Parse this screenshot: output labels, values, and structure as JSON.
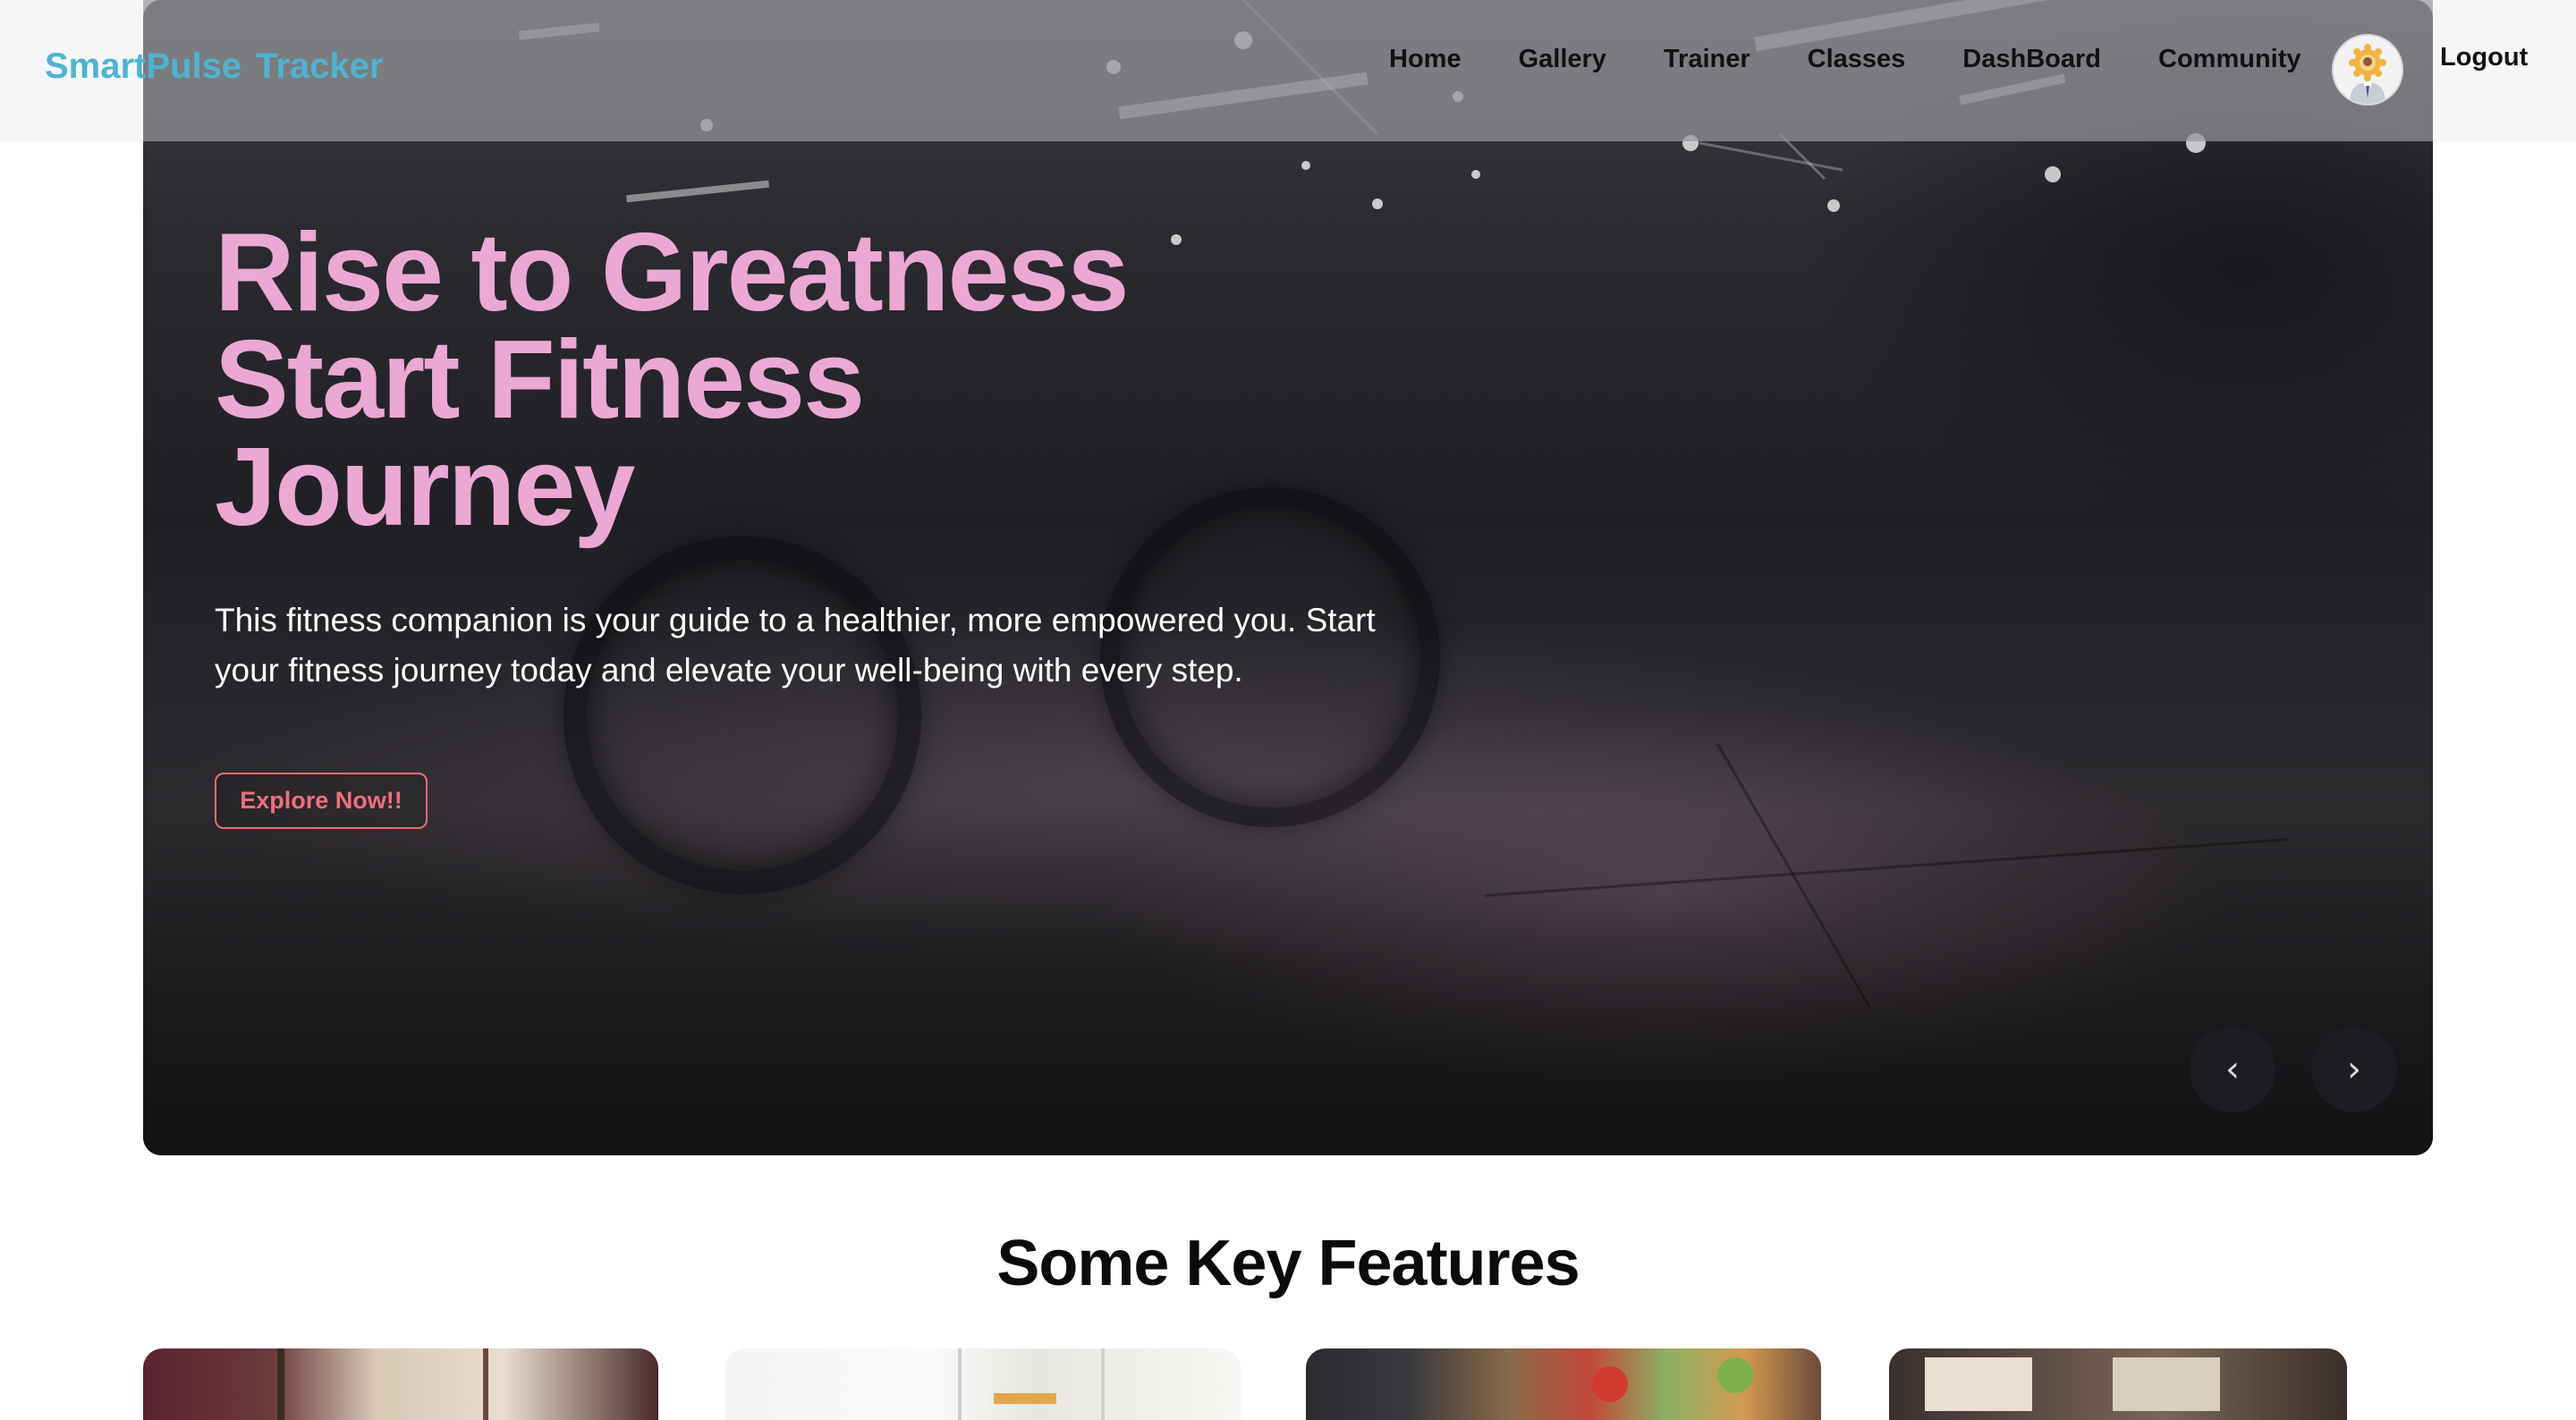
{
  "navbar": {
    "logo_word1": "SmartPulse",
    "logo_word2": "Tracker",
    "links": [
      "Home",
      "Gallery",
      "Trainer",
      "Classes",
      "DashBoard",
      "Community"
    ],
    "logout_label": "Logout",
    "avatar_icon": "user-avatar-icon"
  },
  "hero": {
    "title_lines": [
      "Rise to Greatness",
      "Start Fitness",
      "Journey"
    ],
    "description": "This fitness companion is your guide to a healthier, more empowered you. Start your fitness journey today and elevate your well-being with every step.",
    "cta_label": "Explore Now!!",
    "prev_label": "‹",
    "next_label": "›",
    "title_color": "#eca8d4",
    "cta_color": "#ef6f7c"
  },
  "features": {
    "title": "Some Key Features"
  },
  "colors": {
    "brand": "#4fb3d1"
  }
}
